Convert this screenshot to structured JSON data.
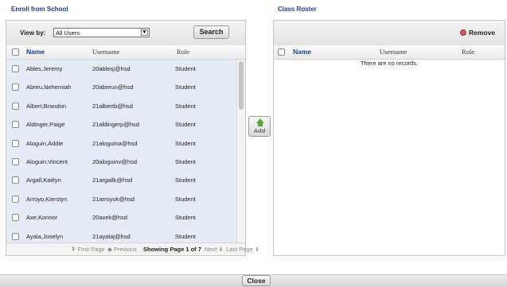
{
  "enroll": {
    "title": "Enroll from School",
    "view_by_label": "View by:",
    "view_by_value": "All Users",
    "search_label": "Search",
    "columns": {
      "name": "Name",
      "username": "Username",
      "role": "Role"
    },
    "rows": [
      {
        "name": "Ables,Jeremy",
        "username": "20ablesj@hsd",
        "role": "Student"
      },
      {
        "name": "Abreu,Nehemiah",
        "username": "20abreun@hsd",
        "role": "Student"
      },
      {
        "name": "Albert,Brandon",
        "username": "21albertb@hsd",
        "role": "Student"
      },
      {
        "name": "Aldinger,Paige",
        "username": "21aldingerp@hsd",
        "role": "Student"
      },
      {
        "name": "Aloguin,Addie",
        "username": "21aloguina@hsd",
        "role": "Student"
      },
      {
        "name": "Aloguin,Vincent",
        "username": "20aloguinv@hsd",
        "role": "Student"
      },
      {
        "name": "Argall,Kaitlyn",
        "username": "21argallk@hsd",
        "role": "Student"
      },
      {
        "name": "Arroyo,Kierstyn",
        "username": "21arroyok@hsd",
        "role": "Student"
      },
      {
        "name": "Axe,Konnor",
        "username": "20axek@hsd",
        "role": "Student"
      },
      {
        "name": "Ayala,Joselyn",
        "username": "21ayalaj@hsd",
        "role": "Student"
      }
    ],
    "pager": {
      "first": "First Page",
      "previous": "Previous",
      "status": "Showing Page 1 of 7",
      "next": "Next",
      "last": "Last Page"
    }
  },
  "add_label": "Add",
  "roster": {
    "title": "Class Roster",
    "remove_label": "Remove",
    "columns": {
      "name": "Name",
      "username": "Username",
      "role": "Role"
    },
    "empty_text": "There are no records."
  },
  "close_label": "Close",
  "colors": {
    "link": "#1f3f8f",
    "list_bg": "#e6ecf5",
    "add_arrow": "#5aa53a",
    "remove_icon": "#c55a5a"
  }
}
